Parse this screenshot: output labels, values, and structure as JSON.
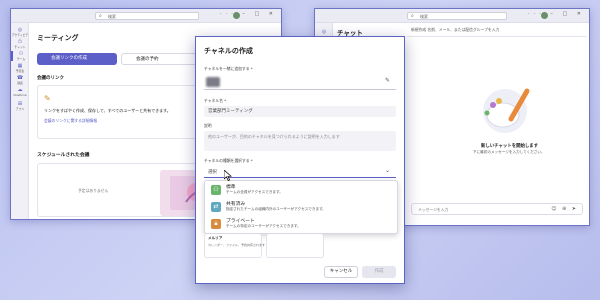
{
  "colors": {
    "accent": "#5b5fc7",
    "background": "#c4caf2"
  },
  "window1": {
    "search": "検索",
    "title": "ミーティング",
    "rail": [
      {
        "icon": "activity-icon",
        "label": "アクティビティ"
      },
      {
        "icon": "chat-icon",
        "label": "チャット"
      },
      {
        "icon": "teams-icon",
        "label": "チーム"
      },
      {
        "icon": "calendar-icon",
        "label": "予定表"
      },
      {
        "icon": "calls-icon",
        "label": "通話"
      },
      {
        "icon": "onedrive-icon",
        "label": "OneDrive"
      },
      {
        "icon": "apps-icon",
        "label": "アプリ"
      }
    ],
    "create_link_button": "会議リンクの作成",
    "schedule_button": "会議の予約",
    "link_section_title": "会議のリンク",
    "link_body": "リンクをすばやく作成、保存して、すべてのユーザーと共有できます。",
    "link_action": "会議のリンクに関する詳細情報",
    "scheduled_title": "スケジュールされた会議",
    "scheduled_empty": "予定はありません"
  },
  "window3": {
    "search": "検索",
    "title": "チャット",
    "to_hint": "新規作成 名前、メール、または配信グループを入力",
    "new_chat_title": "新しいチャットを開始します",
    "new_chat_sub": "下に最初のメッセージを入力してください。",
    "composer_placeholder": "メッセージを入力"
  },
  "dialog": {
    "title": "チャネルの作成",
    "team_label": "チャネルを一緒に追加する *",
    "channel_name_label": "チャネル名 *",
    "channel_name_value": "営業部門ミーティング",
    "description_label": "説明",
    "description_placeholder": "他のユーザーが、目的のチャネルを見つけられるように説明を入力します",
    "type_label": "チャネルの種類を選択する *",
    "type_value": "選択",
    "options": [
      {
        "name": "標準",
        "desc": "チームの全員がアクセスできます。",
        "icon": "team-icon",
        "color": "#6bb56b"
      },
      {
        "name": "共有済み",
        "desc": "指定されたチームの組織内外のユーザーがアクセスできます。",
        "icon": "shared-icon",
        "color": "#5fa8c0"
      },
      {
        "name": "プライベート",
        "desc": "チームの特定のユーザーがアクセスできます。",
        "icon": "lock-icon",
        "color": "#d98c3e"
      }
    ],
    "below_card1_title": "メルリア",
    "below_card1_body": "カレンダー、ファイル、予約共有されます",
    "below_card2_title": "",
    "below_card2_body": "",
    "cancel": "キャンセル",
    "create": "作成"
  }
}
